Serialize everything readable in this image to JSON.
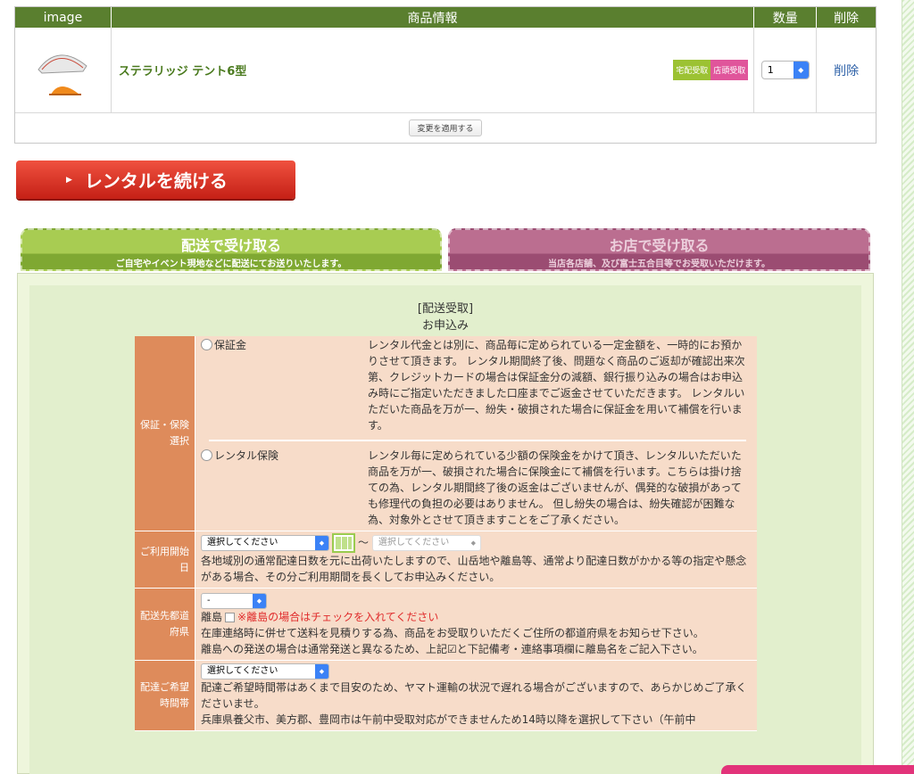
{
  "cart": {
    "headers": {
      "image": "image",
      "info": "商品情報",
      "qty": "数量",
      "delete": "削除"
    },
    "items": [
      {
        "name": "ステラリッジ テント6型",
        "badge_delivery": "宅配受取",
        "badge_store": "店頭受取",
        "qty": "1",
        "delete": "削除"
      }
    ],
    "apply_label": "変更を適用する"
  },
  "continue_label": "レンタルを続ける",
  "tabs": {
    "delivery": {
      "title": "配送で受け取る",
      "sub": "ご自宅やイベント現地などに配送にてお送りいたします。"
    },
    "store": {
      "title": "お店で受け取る",
      "sub": "当店各店舗、及び富士五合目等でお受取いただけます。"
    }
  },
  "form": {
    "title_line1": "[配送受取]",
    "title_line2": "お申込み",
    "guarantee": {
      "label": "保証・保険選択",
      "options": [
        {
          "name": "保証金",
          "desc": "レンタル代金とは別に、商品毎に定められている一定金額を、一時的にお預かりさせて頂きます。 レンタル期間終了後、問題なく商品のご返却が確認出来次第、クレジットカードの場合は保証金分の減額、銀行振り込みの場合はお申込み時にご指定いただきました口座までご返金させていただきます。 レンタルいただいた商品を万が一、紛失・破損された場合に保証金を用いて補償を行います。"
        },
        {
          "name": "レンタル保険",
          "desc": "レンタル毎に定められている少額の保険金をかけて頂き、レンタルいただいた商品を万が一、破損された場合に保険金にて補償を行います。こちらは掛け捨ての為、レンタル期間終了後の返金はございませんが、偶発的な破損があっても修理代の負担の必要はありません。 但し紛失の場合は、紛失確認が困難な為、対象外とさせて頂きますことをご了承ください。"
        }
      ]
    },
    "start_date": {
      "label": "ご利用開始日",
      "select_placeholder": "選択してください",
      "tilde": "〜",
      "end_placeholder": "選択してください",
      "note": "各地域別の通常配達日数を元に出荷いたしますので、山岳地や離島等、通常より配達日数がかかる等の指定や懸念がある場合、その分ご利用期間を長くしてお申込みください。"
    },
    "prefecture": {
      "label": "配送先都道府県",
      "select_value": "-",
      "island_label": "離島",
      "island_warn": "※離島の場合はチェックを入れてください",
      "note1": "在庫連絡時に併せて送料を見積りする為、商品をお受取りいただくご住所の都道府県をお知らせ下さい。",
      "note2": "離島への発送の場合は通常発送と異なるため、上記☑と下記備考・連絡事項欄に離島名をご記入下さい。"
    },
    "delivery_time": {
      "label": "配達ご希望時間帯",
      "select_placeholder": "選択してください",
      "note1": "配達ご希望時間帯はあくまで目安のため、ヤマト運輸の状況で遅れる場合がございますので、あらかじめご了承くださいませ。",
      "note2": "兵庫県養父市、美方郡、豊岡市は午前中受取対応ができませんため14時以降を選択して下さい（午前中"
    }
  }
}
